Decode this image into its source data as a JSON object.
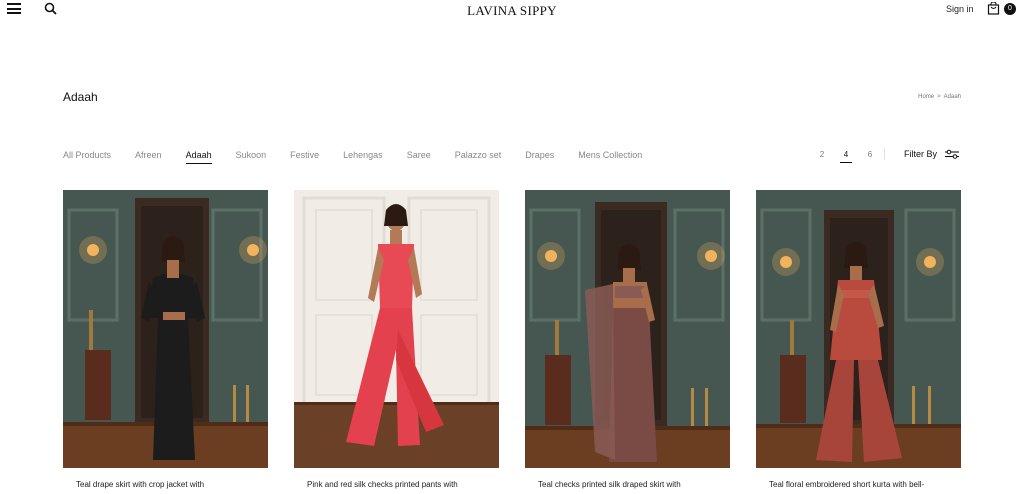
{
  "header": {
    "logo": "LAVINA SIPPY",
    "signin_label": "Sign in",
    "cart_count": "0"
  },
  "page": {
    "title": "Adaah",
    "breadcrumb": {
      "home": "Home",
      "separator": ">",
      "current": "Adaah"
    }
  },
  "tabs": [
    {
      "label": "All Products",
      "active": false
    },
    {
      "label": "Afreen",
      "active": false
    },
    {
      "label": "Adaah",
      "active": true
    },
    {
      "label": "Sukoon",
      "active": false
    },
    {
      "label": "Festive",
      "active": false
    },
    {
      "label": "Lehengas",
      "active": false
    },
    {
      "label": "Saree",
      "active": false
    },
    {
      "label": "Palazzo set",
      "active": false
    },
    {
      "label": "Drapes",
      "active": false
    },
    {
      "label": "Mens Collection",
      "active": false
    }
  ],
  "grid_options": [
    "2",
    "4",
    "6"
  ],
  "grid_selected": "4",
  "filter": {
    "label": "Filter By"
  },
  "products": [
    {
      "title": "Teal drape skirt with crop jacket with"
    },
    {
      "title": "Pink and red silk checks printed pants with"
    },
    {
      "title": "Teal checks printed silk draped skirt with"
    },
    {
      "title": "Teal floral embroidered short kurta with bell-"
    }
  ],
  "colors": {
    "text": "#222222",
    "muted": "#888888",
    "accent": "#111111",
    "wall_teal": "#46584f",
    "floor_wood": "#6b3e22",
    "white_room": "#f1ede6",
    "outfit_black": "#1c1c1c",
    "outfit_pink": "#e84a55",
    "outfit_mauve": "#8a5a55",
    "outfit_floral": "#b84a3e"
  }
}
